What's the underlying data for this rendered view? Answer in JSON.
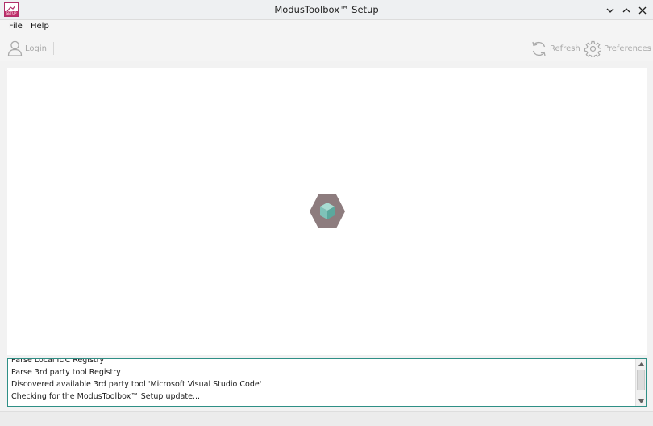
{
  "window": {
    "title": "ModusToolbox™ Setup",
    "app_icon_tag": "SETUP",
    "controls": [
      "minimize",
      "maximize",
      "close"
    ]
  },
  "menubar": {
    "items": [
      {
        "label": "File"
      },
      {
        "label": "Help"
      }
    ]
  },
  "toolbar": {
    "login_label": "Login",
    "refresh_label": "Refresh",
    "preferences_label": "Preferences"
  },
  "content": {
    "loading_icon": "hexagon-cube-spinner",
    "colors": {
      "hexagon": "#8d7c7e",
      "cube_light": "#9fd6cc",
      "cube_mid": "#7fc2b8",
      "cube_dark": "#5aa89d"
    }
  },
  "log": {
    "lines": [
      "Parse Local IDC Registry",
      "Parse 3rd party tool Registry",
      "Discovered available 3rd party tool 'Microsoft Visual Studio Code'",
      "Checking for the ModusToolbox™ Setup update..."
    ],
    "border_color": "#2f8f86"
  }
}
